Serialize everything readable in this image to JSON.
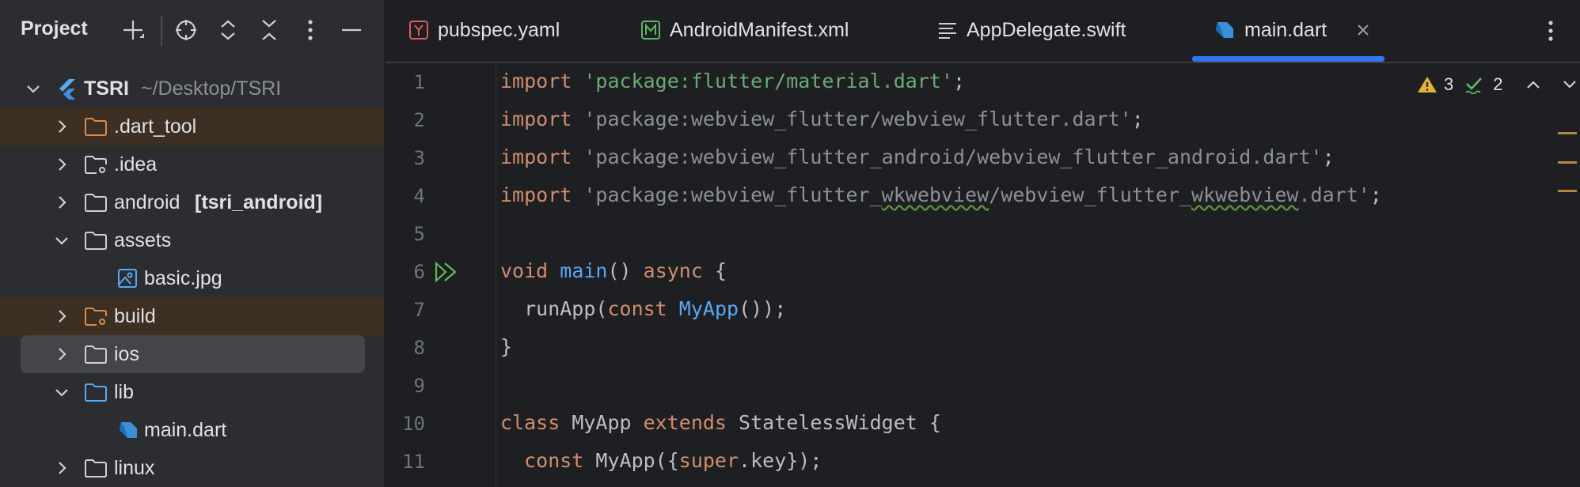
{
  "sidebar": {
    "title": "Project",
    "tree": [
      {
        "label": "TSRI",
        "sub": "~/Desktop/TSRI"
      },
      {
        "label": ".dart_tool"
      },
      {
        "label": ".idea"
      },
      {
        "label": "android",
        "bold": "[tsri_android]"
      },
      {
        "label": "assets"
      },
      {
        "label": "basic.jpg"
      },
      {
        "label": "build"
      },
      {
        "label": "ios"
      },
      {
        "label": "lib"
      },
      {
        "label": "main.dart"
      },
      {
        "label": "linux"
      }
    ]
  },
  "tabs": [
    {
      "label": "pubspec.yaml"
    },
    {
      "label": "AndroidManifest.xml"
    },
    {
      "label": "AppDelegate.swift"
    },
    {
      "label": "main.dart",
      "active": true
    }
  ],
  "inspections": {
    "warnings": "3",
    "ok": "2"
  },
  "gutter": [
    "1",
    "2",
    "3",
    "4",
    "5",
    "6",
    "7",
    "8",
    "9",
    "10",
    "11"
  ],
  "code": {
    "l1": {
      "kw": "import",
      "str": "'package:flutter/material.dart'",
      "end": ";"
    },
    "l2": {
      "kw": "import",
      "str": "'package:webview_flutter/webview_flutter.dart'",
      "end": ";"
    },
    "l3": {
      "kw": "import",
      "str": "'package:webview_flutter_android/webview_flutter_android.dart'",
      "end": ";"
    },
    "l4": {
      "kw": "import",
      "s1": "'package:webview_flutter_",
      "u1": "wkwebview",
      "s2": "/webview_flutter_",
      "u2": "wkwebview",
      "s3": ".dart'",
      "end": ";"
    },
    "l6": {
      "kw": "void",
      "fn": "main",
      "p": "() ",
      "kw2": "async",
      "end": " {"
    },
    "l7": {
      "a": "  runApp(",
      "kw": "const",
      "sp": " ",
      "fn": "MyApp",
      "end": "());"
    },
    "l8": {
      "a": "}"
    },
    "l10": {
      "kw": "class",
      "a": " MyApp ",
      "kw2": "extends",
      "b": " StatelessWidget {"
    },
    "l11": {
      "kw": "  const",
      "a": " MyApp({",
      "kw2": "super",
      "b": ".key});"
    }
  }
}
